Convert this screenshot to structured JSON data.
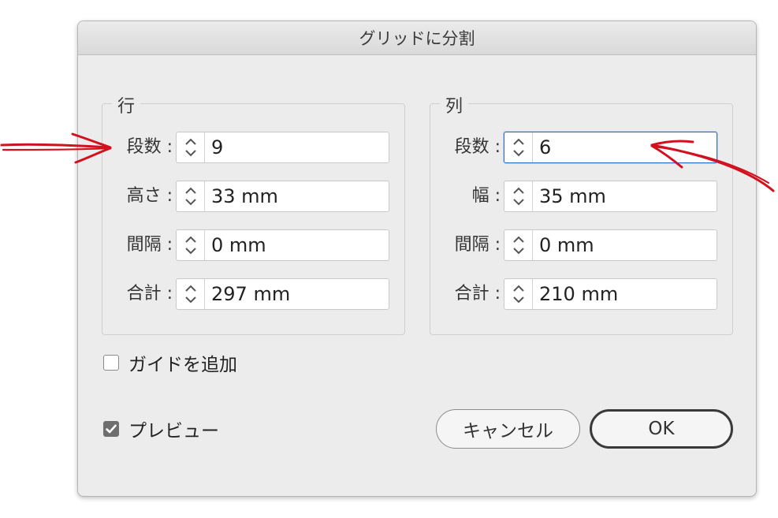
{
  "dialog": {
    "title": "グリッドに分割",
    "rows": {
      "title": "行",
      "fields": [
        {
          "label": "段数 :",
          "value": "9"
        },
        {
          "label": "高さ :",
          "value": "33 mm"
        },
        {
          "label": "間隔 :",
          "value": "0 mm"
        },
        {
          "label": "合計 :",
          "value": "297 mm"
        }
      ]
    },
    "columns": {
      "title": "列",
      "fields": [
        {
          "label": "段数 :",
          "value": "6"
        },
        {
          "label": "幅 :",
          "value": "35 mm"
        },
        {
          "label": "間隔 :",
          "value": "0 mm"
        },
        {
          "label": "合計 :",
          "value": "210 mm"
        }
      ]
    },
    "add_guides": {
      "label": "ガイドを追加",
      "checked": false
    },
    "preview": {
      "label": "プレビュー",
      "checked": true
    },
    "buttons": {
      "cancel": "キャンセル",
      "ok": "OK"
    }
  },
  "annotation_color": "#d2111f",
  "accent_color": "#2f6fc9"
}
